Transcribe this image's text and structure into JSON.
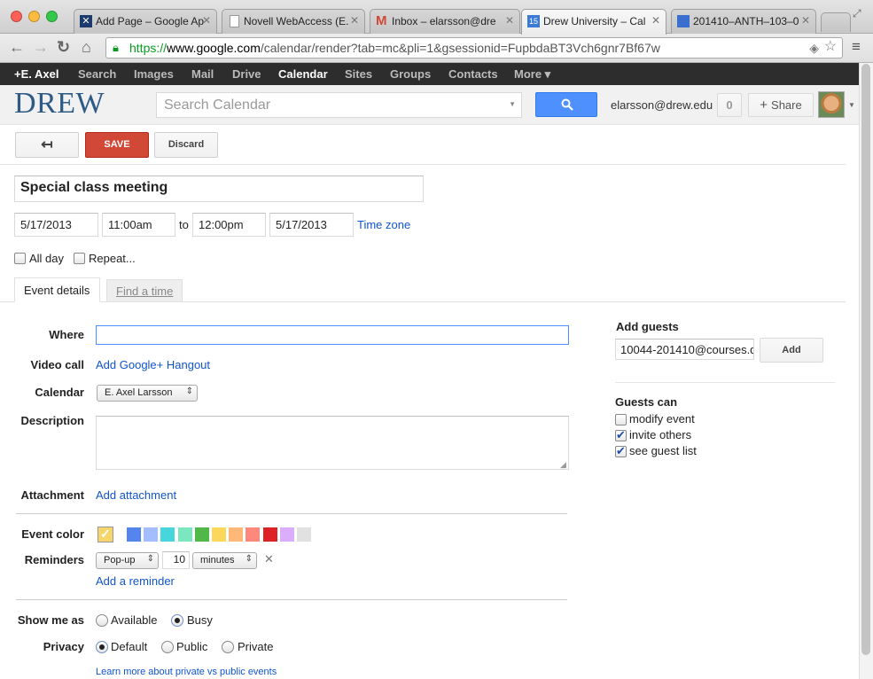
{
  "browser": {
    "tabs": [
      {
        "title": "Add Page – Google Ap"
      },
      {
        "title": "Novell WebAccess (E."
      },
      {
        "title": "Inbox – elarsson@dre"
      },
      {
        "title": "Drew University – Cal"
      },
      {
        "title": "201410–ANTH–103–0"
      }
    ],
    "url_scheme": "https://",
    "url_host": "www.google.com",
    "url_path": "/calendar/render?tab=mc&pli=1&gsessionid=FupbdaBT3Vch6gnr7Bf67w"
  },
  "gbar": {
    "items": [
      "+E. Axel",
      "Search",
      "Images",
      "Mail",
      "Drive",
      "Calendar",
      "Sites",
      "Groups",
      "Contacts",
      "More ▾"
    ]
  },
  "header": {
    "logo": "DREW",
    "search_placeholder": "Search Calendar",
    "email": "elarsson@drew.edu",
    "notif_count": "0",
    "share_label": "Share"
  },
  "toolbar": {
    "back_icon": "back-arrow-icon",
    "save_label": "SAVE",
    "discard_label": "Discard"
  },
  "event": {
    "title": "Special class meeting",
    "start_date": "5/17/2013",
    "start_time": "11:00am",
    "to_label": "to",
    "end_time": "12:00pm",
    "end_date": "5/17/2013",
    "timezone_link": "Time zone",
    "allday_label": "All day",
    "repeat_label": "Repeat...",
    "tabs": {
      "details": "Event details",
      "find_time": "Find a time"
    }
  },
  "details": {
    "where_label": "Where",
    "where_value": "",
    "video_label": "Video call",
    "video_link": "Add Google+ Hangout",
    "calendar_label": "Calendar",
    "calendar_value": "E. Axel Larsson",
    "description_label": "Description",
    "description_value": "",
    "attachment_label": "Attachment",
    "attachment_link": "Add attachment",
    "color_label": "Event color",
    "colors": [
      "#5484ed",
      "#a4bdfc",
      "#46d6db",
      "#7ae7bf",
      "#51b749",
      "#fbd75b",
      "#ffb878",
      "#ff887c",
      "#dc2127",
      "#dbadff",
      "#e1e1e1"
    ],
    "default_color_check": "✓",
    "reminders_label": "Reminders",
    "reminder_type": "Pop-up",
    "reminder_amount": "10",
    "reminder_unit": "minutes",
    "reminder_remove": "✕",
    "add_reminder_link": "Add a reminder",
    "showme_label": "Show me as",
    "available_label": "Available",
    "busy_label": "Busy",
    "privacy_label": "Privacy",
    "default_label": "Default",
    "public_label": "Public",
    "private_label": "Private",
    "learn_more": "Learn more about private vs public events"
  },
  "guests": {
    "heading": "Add guests",
    "input_value": "10044-201410@courses.d",
    "add_label": "Add",
    "can_heading": "Guests can",
    "modify_label": "modify event",
    "invite_label": "invite others",
    "see_label": "see guest list",
    "modify_checked": false,
    "invite_checked": true,
    "see_checked": true
  }
}
